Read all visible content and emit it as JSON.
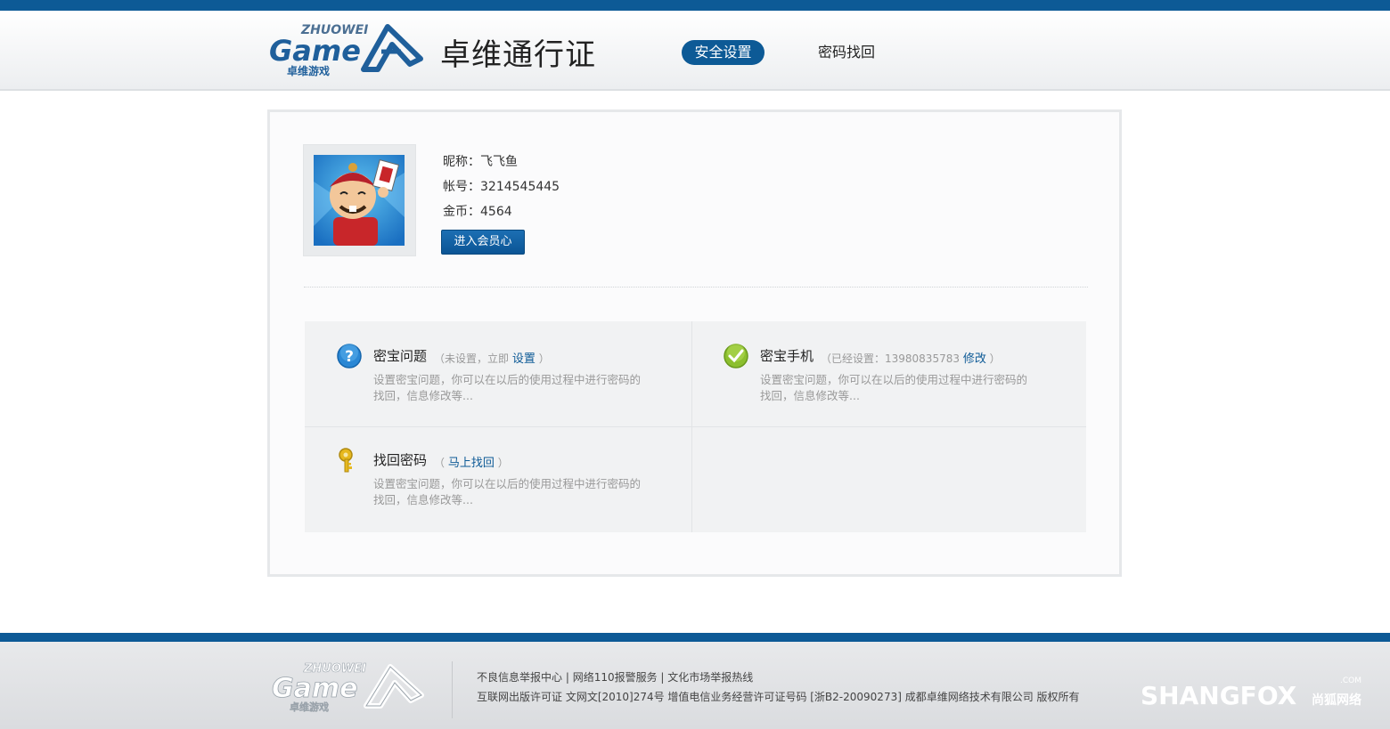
{
  "header": {
    "logo_text_top": "ZHUOWEI",
    "logo_text_main": "Game",
    "logo_text_sub": "卓维游戏",
    "title": "卓维通行证",
    "nav": [
      {
        "label": "安全设置",
        "active": true
      },
      {
        "label": "密码找回",
        "active": false
      }
    ]
  },
  "profile": {
    "nickname_label": "昵称：",
    "nickname": "飞飞鱼",
    "account_label": "帐号：",
    "account": "3214545445",
    "coins_label": "金币：",
    "coins": "4564",
    "member_button": "进入会员心"
  },
  "security": {
    "question": {
      "title": "密宝问题",
      "status_prefix": "（未设置，立即",
      "action": "设置",
      "status_suffix": "）",
      "desc": "设置密宝问题，你可以在以后的使用过程中进行密码的找回，信息修改等..."
    },
    "phone": {
      "title": "密宝手机",
      "status_prefix": "（已经设置：13980835783",
      "action": "修改",
      "status_suffix": "）",
      "desc": "设置密宝问题，你可以在以后的使用过程中进行密码的找回，信息修改等..."
    },
    "recover": {
      "title": "找回密码",
      "status_prefix": "（",
      "action": "马上找回",
      "status_suffix": "）",
      "desc": "设置密宝问题，你可以在以后的使用过程中进行密码的找回，信息修改等..."
    }
  },
  "footer": {
    "links": [
      "不良信息举报中心",
      "网络110报警服务",
      "文化市场举报热线"
    ],
    "separator": " | ",
    "copyright": "互联网出版许可证 文网文[2010]274号 增值电信业务经营许可证号码 [浙B2-20090273] 成都卓维网络技术有限公司 版权所有",
    "partner_logo": "SHANGFOX",
    "partner_logo_cn": "尚狐网络",
    "partner_logo_com": ".COM"
  },
  "colors": {
    "brand_blue": "#0d5a96",
    "link_blue": "#0d5a96"
  }
}
